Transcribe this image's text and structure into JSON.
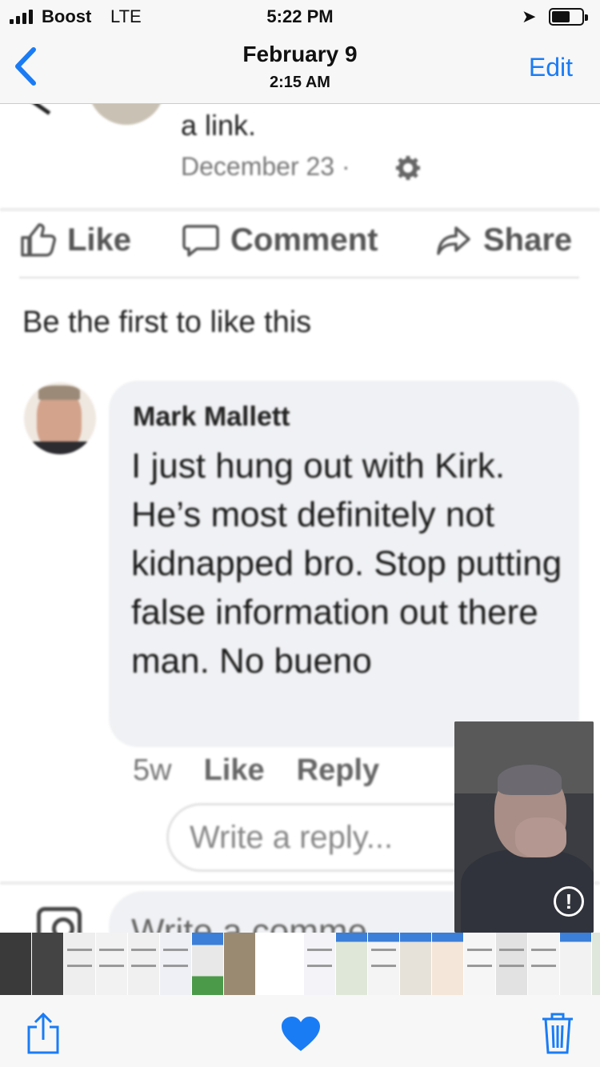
{
  "status_bar": {
    "carrier": "Boost",
    "network": "LTE",
    "time": "5:22 PM"
  },
  "nav": {
    "title": "February 9",
    "subtitle": "2:15 AM",
    "edit_label": "Edit",
    "accent_color": "#1a7cf5"
  },
  "post": {
    "link_text": "a link.",
    "date": "December 23 ·"
  },
  "actions": {
    "like": "Like",
    "comment": "Comment",
    "share": "Share"
  },
  "first_like": "Be the first to like this",
  "comment": {
    "author": "Mark Mallett",
    "text": "I just hung out with Kirk. He’s most definitely not kidnapped bro. Stop putting false information out there man. No bueno",
    "age": "5w",
    "like": "Like",
    "reply": "Reply"
  },
  "reply_placeholder": "Write a reply...",
  "comment_placeholder": "Write a comme",
  "pip": {
    "info_glyph": "!"
  },
  "toolbar": {
    "accent_color": "#1a7cf5"
  }
}
